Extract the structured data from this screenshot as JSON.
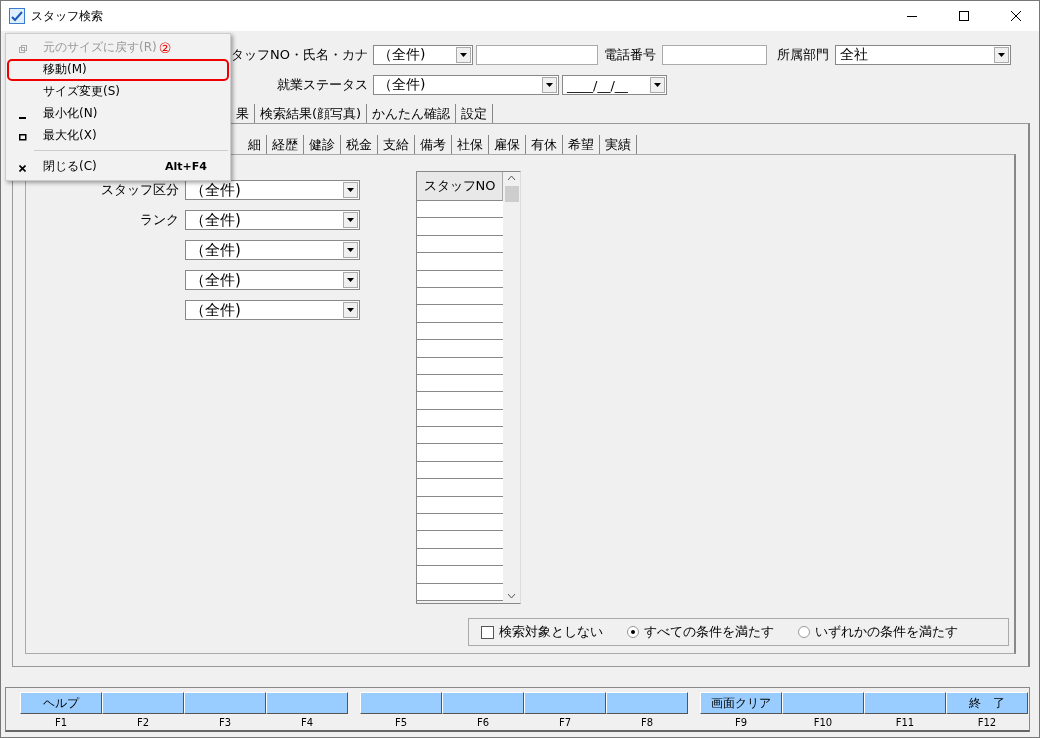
{
  "window": {
    "title": "スタッフ検索"
  },
  "header_fields": {
    "staff_label": "タッフNO・氏名・カナ",
    "staff_combo": "（全件)",
    "phone_label": "電話番号",
    "dept_label": "所属部門",
    "dept_combo": "全社",
    "status_label": "就業ステータス",
    "status_combo": "（全件)",
    "date_combo": "____/__/__"
  },
  "tabs": [
    {
      "label": "果"
    },
    {
      "label": "検索結果(顔写真)"
    },
    {
      "label": "かんたん確認"
    },
    {
      "label": "設定"
    }
  ],
  "sub_tabs": [
    {
      "label": "細"
    },
    {
      "label": "経歴"
    },
    {
      "label": "健診"
    },
    {
      "label": "税金"
    },
    {
      "label": "支給"
    },
    {
      "label": "備考"
    },
    {
      "label": "社保"
    },
    {
      "label": "雇保"
    },
    {
      "label": "有休"
    },
    {
      "label": "希望"
    },
    {
      "label": "実績"
    }
  ],
  "filters": [
    {
      "label": "スタッフ区分",
      "value": "（全件)"
    },
    {
      "label": "ランク",
      "value": "（全件)"
    },
    {
      "value": "（全件)"
    },
    {
      "value": "（全件)"
    },
    {
      "value": "（全件)"
    }
  ],
  "grid": {
    "columns": [
      "スタッフNO"
    ]
  },
  "options": [
    {
      "kind": "checkbox",
      "label": "検索対象としない",
      "checked": false
    },
    {
      "kind": "radio",
      "label": "すべての条件を満たす",
      "selected": true
    },
    {
      "kind": "radio",
      "label": "いずれかの条件を満たす",
      "selected": false
    }
  ],
  "function_keys": [
    {
      "label": "ヘルプ",
      "key": "F1"
    },
    {
      "key": "F2"
    },
    {
      "key": "F3"
    },
    {
      "key": "F4"
    },
    {
      "key": "F5"
    },
    {
      "key": "F6"
    },
    {
      "key": "F7"
    },
    {
      "key": "F8"
    },
    {
      "label": "画面クリア",
      "key": "F9"
    },
    {
      "key": "F10"
    },
    {
      "key": "F11"
    },
    {
      "label": "終　了",
      "key": "F12"
    }
  ],
  "system_menu": {
    "annotation": "②",
    "items": [
      {
        "kind": "item",
        "label": "元のサイズに戻す(R)",
        "disabled": true,
        "highlighted": false
      },
      {
        "kind": "item",
        "label": "移動(M)",
        "disabled": false,
        "highlighted": true
      },
      {
        "kind": "item",
        "label": "サイズ変更(S)",
        "disabled": false,
        "highlighted": false
      },
      {
        "kind": "item",
        "label": "最小化(N)",
        "disabled": false,
        "highlighted": false
      },
      {
        "kind": "item",
        "label": "最大化(X)",
        "disabled": false,
        "highlighted": false
      },
      {
        "kind": "separator"
      },
      {
        "kind": "item",
        "label": "閉じる(C)",
        "shortcut": "Alt+F4",
        "disabled": false,
        "highlighted": false
      }
    ]
  }
}
